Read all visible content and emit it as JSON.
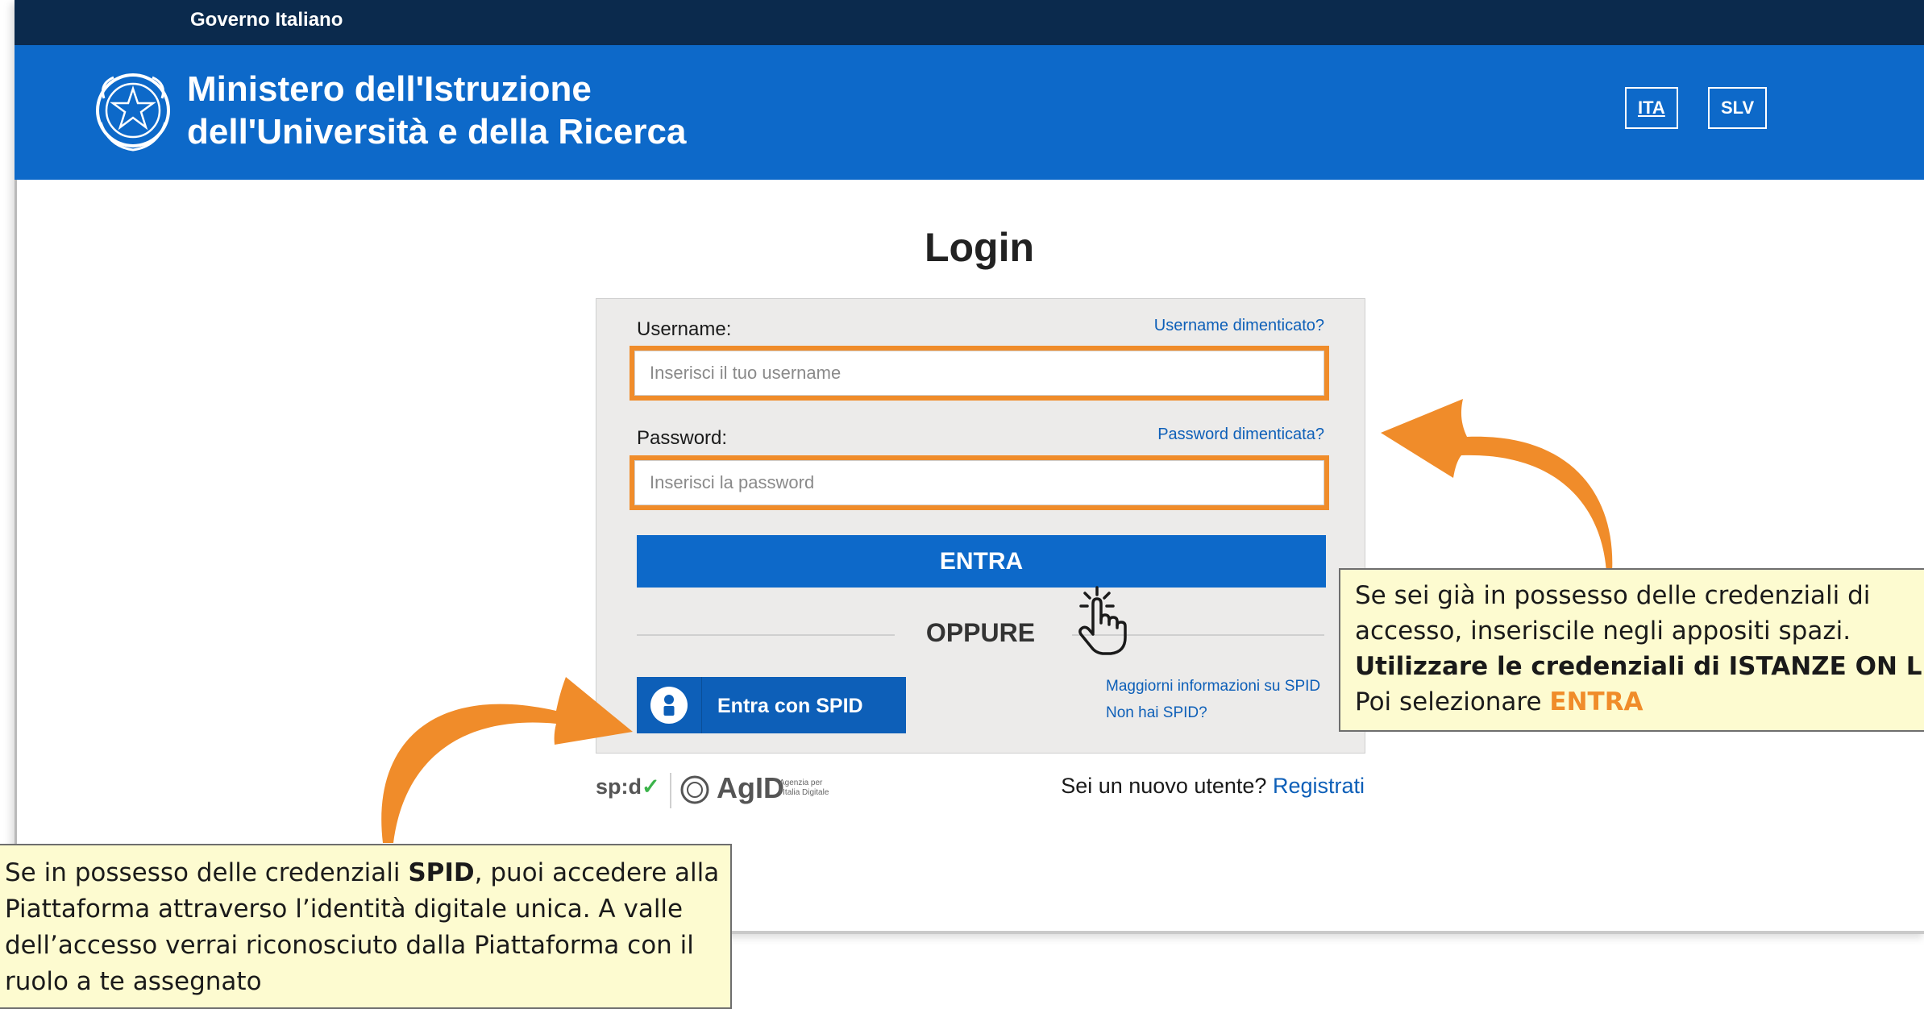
{
  "gov_bar": {
    "label": "Governo Italiano"
  },
  "header": {
    "ministry_line1": "Ministero dell'Istruzione",
    "ministry_line2": "dell'Università e della Ricerca",
    "lang_ita": "ITA",
    "lang_slv": "SLV"
  },
  "login": {
    "title": "Login",
    "username_label": "Username:",
    "username_forgot": "Username dimenticato?",
    "username_placeholder": "Inserisci il tuo username",
    "password_label": "Password:",
    "password_forgot": "Password dimenticata?",
    "password_placeholder": "Inserisci la password",
    "submit_label": "ENTRA",
    "or_label": "OPPURE",
    "spid_button": "Entra con SPID",
    "spid_more_info": "Maggiorni informazioni su SPID",
    "spid_no_account": "Non hai SPID?"
  },
  "footer": {
    "spid_logo": "sp:d",
    "agid_logo": "AgID",
    "agid_sub_line1": "Agenzia per",
    "agid_sub_line2": "l'Italia Digitale",
    "new_user_text": "Sei un nuovo utente?",
    "register_link": "Registrati"
  },
  "annotations": {
    "right_line1": "Se sei già in possesso delle credenziali di",
    "right_line2": "accesso, inseriscile negli appositi spazi.",
    "right_line3": "Utilizzare le credenziali di ISTANZE ON LINE.",
    "right_line4_prefix": "Poi selezionare ",
    "right_line4_highlight": "ENTRA",
    "left_part1": "Se in possesso delle credenziali ",
    "left_bold": "SPID",
    "left_part2": ", puoi accedere alla Piattaforma attraverso l’identità digitale unica. A valle dell’accesso verrai riconosciuto dalla Piattaforma con il ruolo a te assegnato"
  },
  "colors": {
    "gov_bar": "#0b2a4d",
    "header_blue": "#0d69c9",
    "accent_orange": "#f08c2a",
    "note_bg": "#fdfbd0",
    "link_blue": "#0d5fb8"
  },
  "icons": [
    "emblem-icon",
    "spid-user-icon",
    "hand-pointer-icon",
    "curved-arrow-icon"
  ]
}
